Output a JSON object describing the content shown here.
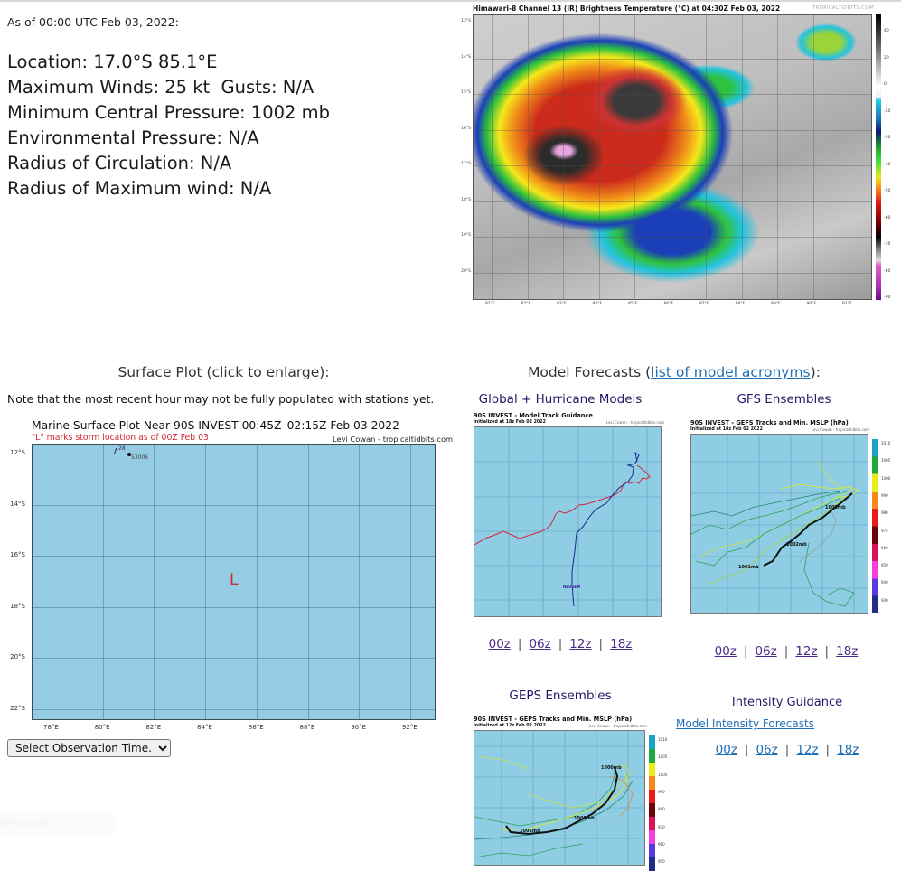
{
  "as_of": "As of 00:00 UTC Feb 03, 2022:",
  "stats": {
    "location": "Location: 17.0°S 85.1°E",
    "max_winds": "Maximum Winds: 25 kt  Gusts: N/A",
    "min_pressure": "Minimum Central Pressure: 1002 mb",
    "env_pressure": "Environmental Pressure: N/A",
    "radius_circulation": "Radius of Circulation: N/A",
    "radius_max_wind": "Radius of Maximum wind: N/A"
  },
  "satellite": {
    "title": "Himawari-8 Channel 13 (IR) Brightness Temperature (°C) at 04:30Z Feb 03, 2022",
    "credit": "TROPICALTIDBITS.COM",
    "lat_labels": [
      "13°S",
      "14°S",
      "15°S",
      "16°S",
      "17°S",
      "18°S",
      "19°S",
      "20°S"
    ],
    "lon_labels": [
      "81°E",
      "82°E",
      "83°E",
      "84°E",
      "85°E",
      "86°E",
      "87°E",
      "88°E",
      "89°E",
      "90°E",
      "91°E"
    ],
    "colorbar_labels": [
      "40",
      "20",
      "0",
      "-20",
      "-30",
      "-40",
      "-50",
      "-60",
      "-70",
      "-80",
      "-90"
    ]
  },
  "surface": {
    "heading": "Surface Plot (click to enlarge):",
    "note": "Note that the most recent hour may not be fully populated with stations yet.",
    "title": "Marine Surface Plot Near 90S INVEST 00:45Z–02:15Z Feb 03 2022",
    "subtitle": "\"L\" marks storm location as of 00Z Feb 03",
    "credit": "Levi Cowan - tropicaltidbits.com",
    "lat_labels": [
      "12°S",
      "14°S",
      "16°S",
      "18°S",
      "20°S",
      "22°S"
    ],
    "lon_labels": [
      "78°E",
      "80°E",
      "82°E",
      "84°E",
      "86°E",
      "88°E",
      "90°E",
      "92°E"
    ],
    "storm_marker": "L",
    "station": {
      "id": "53006",
      "value": "28"
    },
    "select_label": "Select Observation Time..."
  },
  "models": {
    "heading_prefix": "Model Forecasts (",
    "heading_link": "list of model acronyms",
    "heading_suffix": "):",
    "global": {
      "heading": "Global + Hurricane Models",
      "title": "90S INVEST - Model Track Guidance",
      "init": "Initialized at 18z Feb 02 2022",
      "credit": "Levi Cowan - tropicaltidbits.com",
      "links": [
        "00z",
        "06z",
        "12z",
        "18z"
      ]
    },
    "gfs": {
      "heading": "GFS Ensembles",
      "title": "90S INVEST - GEFS Tracks and Min. MSLP (hPa)",
      "init": "Initialized at 18z Feb 02 2022",
      "credit": "Levi Cowan - tropicaltidbits.com",
      "colorbar_labels": [
        "1010",
        "1005",
        "1000",
        "990",
        "980",
        "975",
        "960",
        "950",
        "940",
        "930"
      ],
      "links": [
        "00z",
        "06z",
        "12z",
        "18z"
      ]
    },
    "geps": {
      "heading": "GEPS Ensembles",
      "title": "90S INVEST - GEPS Tracks and Min. MSLP (hPa)",
      "init": "Initialized at 12z Feb 02 2022",
      "credit": "Levi Cowan - tropicaltidbits.com",
      "colorbar_labels": [
        "1010",
        "1005",
        "1000",
        "990",
        "980",
        "970",
        "960",
        "950"
      ]
    },
    "intensity": {
      "heading": "Intensity Guidance",
      "link": "Model Intensity Forecasts",
      "links": [
        "00z",
        "06z",
        "12z",
        "18z"
      ]
    }
  },
  "faint_text": "ePlan.com"
}
